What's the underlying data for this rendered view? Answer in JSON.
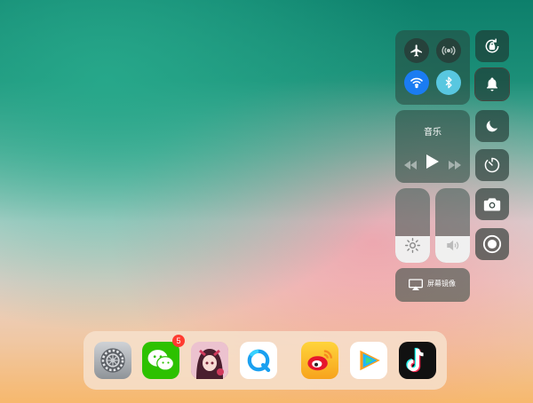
{
  "control_center": {
    "music": {
      "title": "音乐"
    },
    "mirror": {
      "label": "屏幕镜像"
    },
    "brightness": {
      "level": 0.36
    },
    "volume": {
      "level": 0.36
    },
    "colors": {
      "wifi_active": "#1a7cf2",
      "bluetooth_active": "#58c7e0"
    }
  },
  "dock": {
    "apps": [
      {
        "name": "settings"
      },
      {
        "name": "wechat",
        "badge": "5"
      },
      {
        "name": "game"
      },
      {
        "name": "browser"
      },
      {
        "name": "weibo"
      },
      {
        "name": "tencent-video"
      },
      {
        "name": "tiktok"
      }
    ]
  }
}
